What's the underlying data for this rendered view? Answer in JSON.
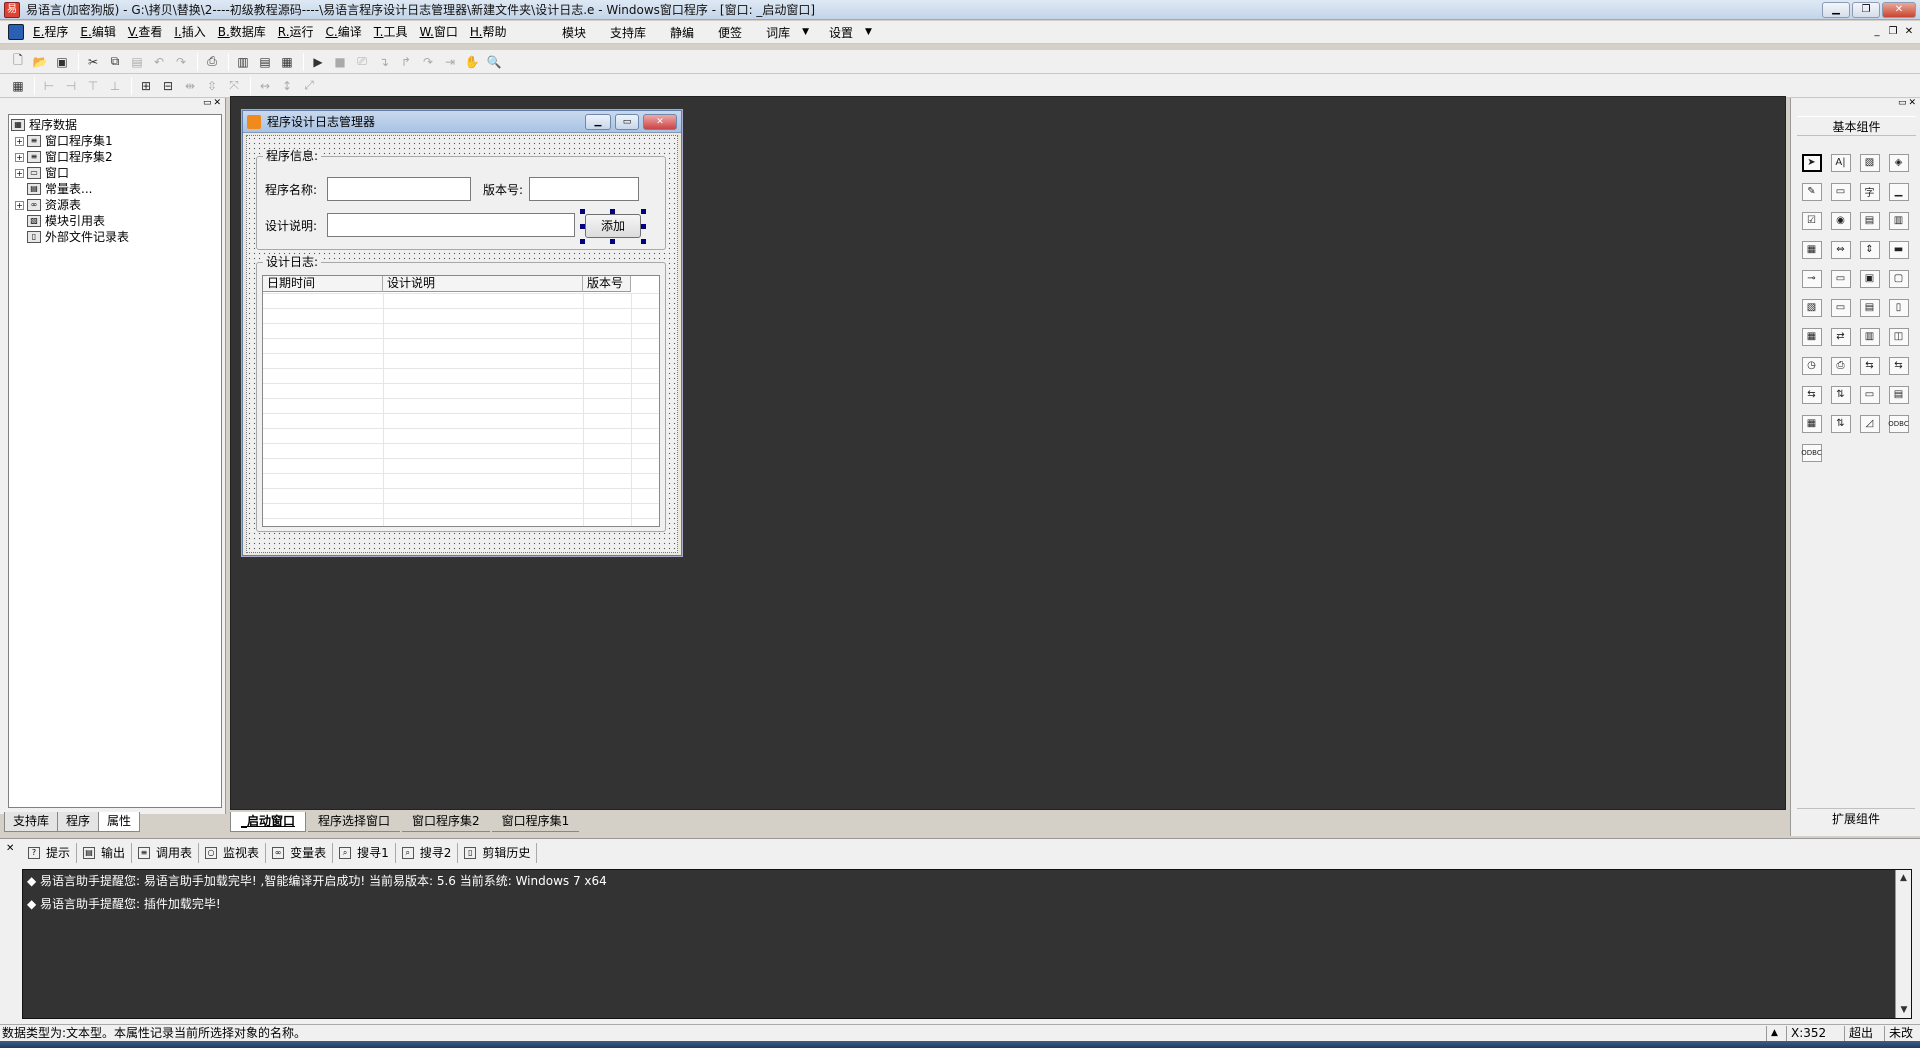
{
  "window": {
    "title": "易语言(加密狗版) - G:\\拷贝\\替换\\2----初级教程源码----\\易语言程序设计日志管理器\\新建文件夹\\设计日志.e - Windows窗口程序 - [窗口: _启动窗口]",
    "app_icon": "e-logo-icon"
  },
  "menu": {
    "items": [
      "E.程序",
      "E.编辑",
      "V.查看",
      "I.插入",
      "B.数据库",
      "R.运行",
      "C.编译",
      "T.工具",
      "W.窗口",
      "H.帮助"
    ],
    "right_items": [
      "模块",
      "支持库",
      "静编",
      "便签",
      "词库",
      "设置"
    ]
  },
  "toolbar1": {
    "icons": [
      "new-file-icon",
      "open-folder-icon",
      "save-icon",
      "cut-icon",
      "copy-icon",
      "paste-icon",
      "undo-icon",
      "redo-icon",
      "preview-icon",
      "layout-icon-1",
      "layout-icon-2",
      "layout-icon-3",
      "run-icon",
      "stop-icon",
      "step-icon",
      "step-into-icon",
      "step-out-icon",
      "step-over-icon",
      "run-to-cursor-icon",
      "hand-icon",
      "find-icon"
    ]
  },
  "toolbar2": {
    "icons": [
      "grid-icon",
      "align-left-icon",
      "align-right-icon",
      "align-top-icon",
      "align-bottom-icon",
      "center-h-icon",
      "center-v-icon",
      "same-width-icon",
      "same-height-icon",
      "same-size-icon",
      "h-spacing-icon",
      "v-spacing-icon",
      "fit-icon"
    ]
  },
  "tree": {
    "root": "程序数据",
    "nodes": [
      {
        "label": "窗口程序集1",
        "expandable": true
      },
      {
        "label": "窗口程序集2",
        "expandable": true
      },
      {
        "label": "窗口",
        "expandable": true
      },
      {
        "label": "常量表...",
        "expandable": false
      },
      {
        "label": "资源表",
        "expandable": true
      },
      {
        "label": "模块引用表",
        "expandable": false
      },
      {
        "label": "外部文件记录表",
        "expandable": false
      }
    ]
  },
  "left_tabs": [
    "支持库",
    "程序",
    "属性"
  ],
  "form": {
    "title": "程序设计日志管理器",
    "group1_label": "程序信息:",
    "name_label": "程序名称:",
    "version_label": "版本号:",
    "desc_label": "设计说明:",
    "add_button": "添加",
    "group2_label": "设计日志:",
    "columns": [
      "日期时间",
      "设计说明",
      "版本号"
    ]
  },
  "doc_tabs": [
    "_启动窗口",
    "程序选择窗口",
    "窗口程序集2",
    "窗口程序集1"
  ],
  "components": {
    "title": "基本组件",
    "footer": "扩展组件",
    "items": [
      "pointer-icon",
      "label-icon",
      "picture-icon",
      "shape-icon",
      "edit-icon",
      "textbox-icon",
      "font-icon",
      "line-icon",
      "checkbox-icon",
      "radio-icon",
      "listbox-icon",
      "combobox-icon",
      "grid-icon",
      "scroll-icon",
      "vscroll-icon",
      "progress-icon",
      "slider-icon",
      "tab-icon",
      "calendar-icon",
      "frame-icon",
      "panel-icon",
      "input-icon",
      "folder-icon",
      "file-icon",
      "table-icon",
      "network-icon",
      "split-icon",
      "db-icon",
      "timer-icon",
      "printer-icon",
      "socket-icon",
      "client-icon",
      "server-icon",
      "port-icon",
      "toolbar-icon",
      "statusbar-icon",
      "treeview-icon",
      "db-connect-icon",
      "chart-icon",
      "odbc-icon",
      "odbc-db-icon"
    ],
    "letters": {
      "label-icon": "A|",
      "font-icon": "字",
      "odbc-icon": "ODBC",
      "odbc-db-icon": "ODBC"
    }
  },
  "bottom_tabs": [
    "提示",
    "输出",
    "调用表",
    "监视表",
    "变量表",
    "搜寻1",
    "搜寻2",
    "剪辑历史"
  ],
  "output": {
    "lines": [
      "◆ 易语言助手提醒您: 易语言助手加载完毕! ,智能编译开启成功! 当前易版本: 5.6 当前系统: Windows 7 x64",
      "◆ 易语言助手提醒您: 插件加载完毕!"
    ]
  },
  "status": {
    "text": "数据类型为:文本型。本属性记录当前所选择对象的名称。",
    "x": "X:352",
    "mode": "超出",
    "lang": "未改"
  }
}
